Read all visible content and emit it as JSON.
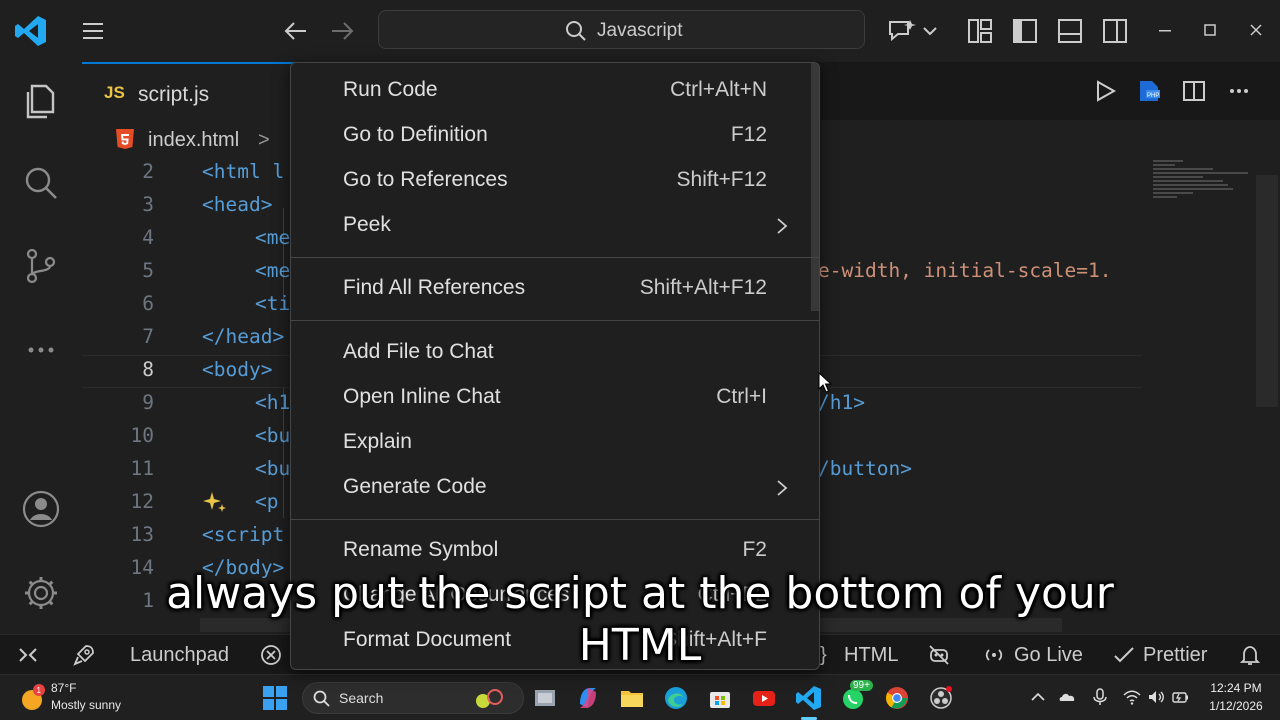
{
  "titlebar": {
    "search_text": "Javascript"
  },
  "tab": {
    "language_badge": "JS",
    "filename": "script.js"
  },
  "breadcrumb": {
    "file": "index.html",
    "separator": ">"
  },
  "code_lines": [
    {
      "num": "2",
      "text": "<html l",
      "active": false
    },
    {
      "num": "3",
      "text": "<head>",
      "active": false
    },
    {
      "num": "4",
      "text": "<me",
      "active": false
    },
    {
      "num": "5",
      "text": "<me",
      "active": false
    },
    {
      "num": "6",
      "text": "<ti",
      "active": false
    },
    {
      "num": "7",
      "text": "</head>",
      "active": false
    },
    {
      "num": "8",
      "text": "<body>",
      "active": true
    },
    {
      "num": "9",
      "text": "<h1",
      "active": false
    },
    {
      "num": "10",
      "text": "<bu",
      "active": false
    },
    {
      "num": "11",
      "text": "<bu",
      "active": false
    },
    {
      "num": "12",
      "text": "<p",
      "active": false
    },
    {
      "num": "13",
      "text": "<script",
      "active": false
    },
    {
      "num": "14",
      "text": "</body>",
      "active": false
    },
    {
      "num": "1",
      "text": "",
      "active": false
    }
  ],
  "code_right": {
    "line5": "e-width, initial-scale=1.",
    "line9": "/h1>",
    "line11": "/button>"
  },
  "context_menu": {
    "groups": [
      [
        {
          "label": "Run Code",
          "shortcut": "Ctrl+Alt+N",
          "submenu": false
        },
        {
          "label": "Go to Definition",
          "shortcut": "F12",
          "submenu": false
        },
        {
          "label": "Go to References",
          "shortcut": "Shift+F12",
          "submenu": false
        },
        {
          "label": "Peek",
          "shortcut": "",
          "submenu": true
        }
      ],
      [
        {
          "label": "Find All References",
          "shortcut": "Shift+Alt+F12",
          "submenu": false
        }
      ],
      [
        {
          "label": "Add File to Chat",
          "shortcut": "",
          "submenu": false
        },
        {
          "label": "Open Inline Chat",
          "shortcut": "Ctrl+I",
          "submenu": false
        },
        {
          "label": "Explain",
          "shortcut": "",
          "submenu": false
        },
        {
          "label": "Generate Code",
          "shortcut": "",
          "submenu": true
        }
      ],
      [
        {
          "label": "Rename Symbol",
          "shortcut": "F2",
          "submenu": false
        },
        {
          "label": "Change All Occurrences",
          "shortcut": "Ctrl+F2",
          "submenu": false
        },
        {
          "label": "Format Document",
          "shortcut": "Shift+Alt+F",
          "submenu": false
        }
      ]
    ]
  },
  "statusbar": {
    "launchpad": "Launchpad",
    "language": "HTML",
    "golive": "Go Live",
    "prettier": "Prettier"
  },
  "taskbar": {
    "temperature": "87°F",
    "condition": "Mostly sunny",
    "search_label": "Search",
    "whatsapp_badge": "99+",
    "time": "12:24 PM",
    "date": "1/12/2026"
  },
  "subtitle": {
    "line1": "always put the script at the bottom of your",
    "line2": "HTML"
  },
  "colors": {
    "accent": "#0078d4",
    "vscode_blue": "#23a8f2",
    "tag_blue": "#569cd6",
    "string_orange": "#ce9178",
    "js_yellow": "#e8c547"
  }
}
